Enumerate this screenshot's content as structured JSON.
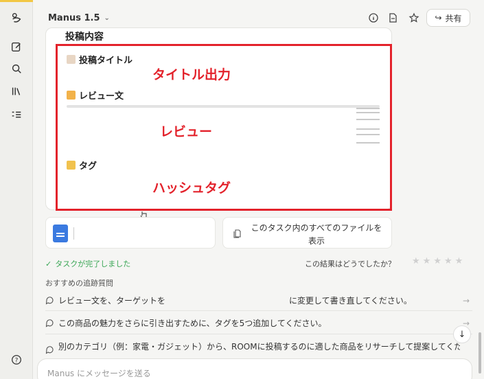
{
  "header": {
    "app_title": "Manus 1.5",
    "share_label": "共有"
  },
  "card": {
    "title": "投稿内容",
    "sections": [
      {
        "label": "投稿タイトル",
        "emoji": "page-icon"
      },
      {
        "label": "レビュー文",
        "emoji": "writing-hand-icon"
      },
      {
        "label": "タグ",
        "emoji": "tag-icon"
      }
    ]
  },
  "annotations": {
    "title_output": "タイトル出力",
    "review": "レビュー",
    "hashtag": "ハッシュタグ"
  },
  "files": {
    "view_all": "このタスク内のすべてのファイルを表示"
  },
  "status": {
    "done": "タスクが完了しました",
    "rating_question": "この結果はどうでしたか？"
  },
  "suggestions": {
    "title": "おすすめの追跡質問",
    "items": [
      "レビュー文を、ターゲットを　　　　　　　　　　　　　　　に変更して書き直してください。",
      "この商品の魅力をさらに引き出すために、タグを5つ追加してください。",
      "別のカテゴリ（例：家電・ガジェット）から、ROOMに投稿するのに適した商品をリサーチして提案してください。"
    ]
  },
  "input": {
    "placeholder": "Manus にメッセージを送る"
  },
  "colors": {
    "accent_red": "#e3222b",
    "success_green": "#3aa655",
    "doc_blue": "#3b7ae0"
  }
}
